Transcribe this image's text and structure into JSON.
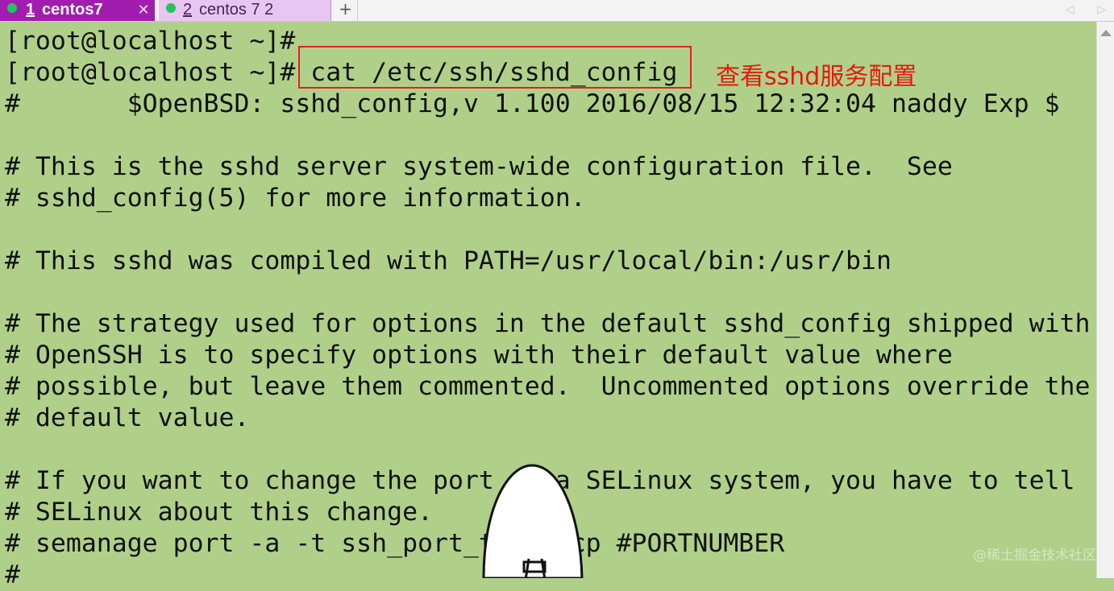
{
  "tabs": [
    {
      "number": "1",
      "label": " centos7",
      "close": "✕"
    },
    {
      "number": "2",
      "label": " centos 7 2"
    }
  ],
  "new_tab": "+",
  "nav": {
    "left": "◁",
    "right": "▷"
  },
  "terminal": {
    "lines": [
      "[root@localhost ~]#",
      "[root@localhost ~]# cat /etc/ssh/sshd_config",
      "#       $OpenBSD: sshd_config,v 1.100 2016/08/15 12:32:04 naddy Exp $",
      "",
      "# This is the sshd server system-wide configuration file.  See",
      "# sshd_config(5) for more information.",
      "",
      "# This sshd was compiled with PATH=/usr/local/bin:/usr/bin",
      "",
      "# The strategy used for options in the default sshd_config shipped with",
      "# OpenSSH is to specify options with their default value where",
      "# possible, but leave them commented.  Uncommented options override the",
      "# default value.",
      "",
      "# If you want to change the port on a SELinux system, you have to tell",
      "# SELinux about this change.",
      "# semanage port -a -t ssh_port_t -p tcp #PORTNUMBER",
      "#"
    ]
  },
  "annotation": {
    "text": "查看sshd服务配置",
    "color": "#e8180c"
  },
  "watermark": "@稀土掘金技术社区",
  "colors": {
    "terminal_bg": "#b0d08a",
    "active_tab": "#a21caf",
    "inactive_tab": "#e8c6f1",
    "status_dot": "#22c55e",
    "highlight": "#e02020"
  }
}
